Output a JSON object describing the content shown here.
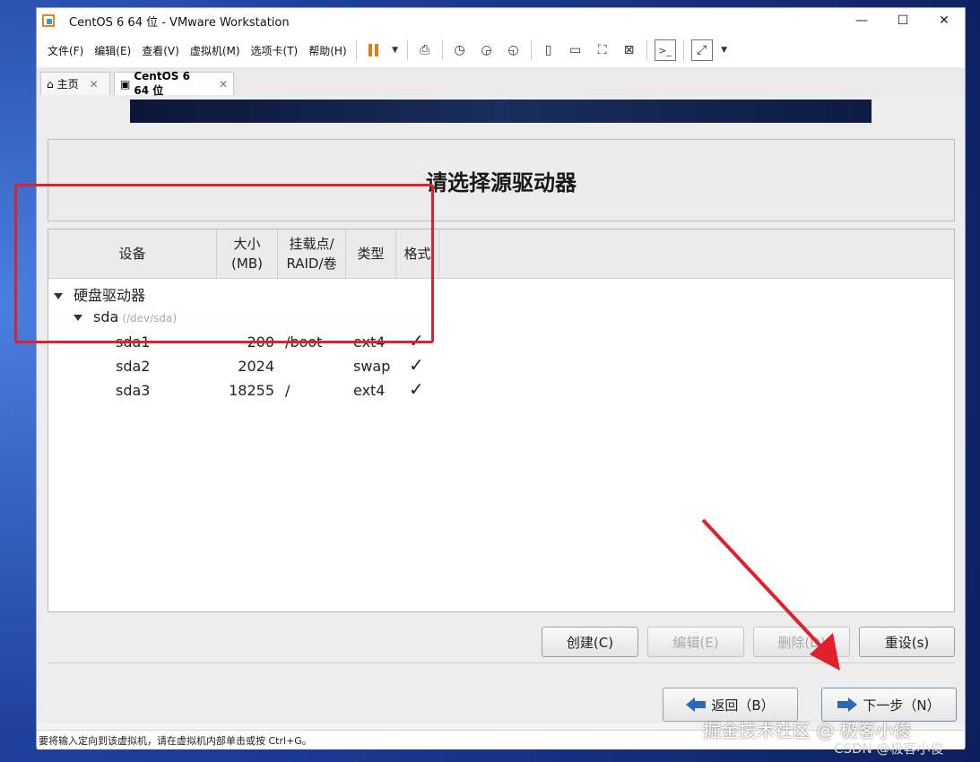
{
  "window": {
    "title": "CentOS 6 64 位 - VMware Workstation",
    "minimize": "—",
    "maximize": "☐",
    "close": "✕"
  },
  "menu": [
    "文件(F)",
    "编辑(E)",
    "查看(V)",
    "虚拟机(M)",
    "选项卡(T)",
    "帮助(H)"
  ],
  "tabs": {
    "home": "主页",
    "vm": "CentOS 6 64 位",
    "close": "✕"
  },
  "installer": {
    "heading": "请选择源驱动器",
    "columns": {
      "device": "设备",
      "size_l1": "大小",
      "size_l2": "(MB)",
      "mount_l1": "挂载点/",
      "mount_l2": "RAID/卷",
      "type": "类型",
      "format": "格式"
    },
    "tree": {
      "group": "硬盘驱动器",
      "disk": "sda",
      "disk_path": "(/dev/sda)",
      "partitions": [
        {
          "name": "sda1",
          "size": "200",
          "mount": "/boot",
          "type": "ext4",
          "format": "✓"
        },
        {
          "name": "sda2",
          "size": "2024",
          "mount": "",
          "type": "swap",
          "format": "✓"
        },
        {
          "name": "sda3",
          "size": "18255",
          "mount": "/",
          "type": "ext4",
          "format": "✓"
        }
      ]
    },
    "buttons": {
      "create": "创建(C)",
      "edit": "编辑(E)",
      "delete": "删除(D)",
      "reset": "重设(s)"
    },
    "nav": {
      "back": "返回（B）",
      "next": "下一步（N）"
    }
  },
  "statusbar": "要将输入定向到该虚拟机，请在虚拟机内部单击或按 Ctrl+G。",
  "watermark": {
    "line1": "掘金技术社区 @ 极客小俊",
    "line2": "CSDN @极客小俊"
  },
  "colors": {
    "highlight": "#e0202a",
    "arrow": "#e0202a",
    "pause": "#e27b15"
  }
}
